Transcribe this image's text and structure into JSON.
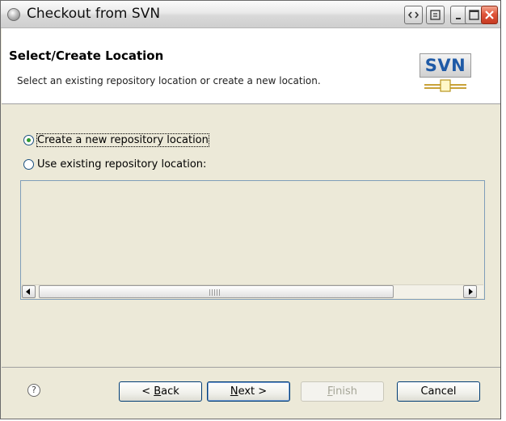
{
  "window": {
    "title": "Checkout from SVN"
  },
  "header": {
    "title": "Select/Create Location",
    "description": "Select an existing repository location or create a new location.",
    "logo_text": "SVN"
  },
  "options": {
    "create_new": {
      "label": "Create a new repository location",
      "selected": true
    },
    "use_existing": {
      "label": "Use existing repository location:",
      "selected": false
    }
  },
  "buttons": {
    "back": {
      "pre": "< ",
      "mnemonic": "B",
      "rest": "ack"
    },
    "next": {
      "mnemonic": "N",
      "rest": "ext >"
    },
    "finish": {
      "mnemonic": "F",
      "rest": "inish"
    },
    "cancel": "Cancel"
  },
  "help": "?"
}
